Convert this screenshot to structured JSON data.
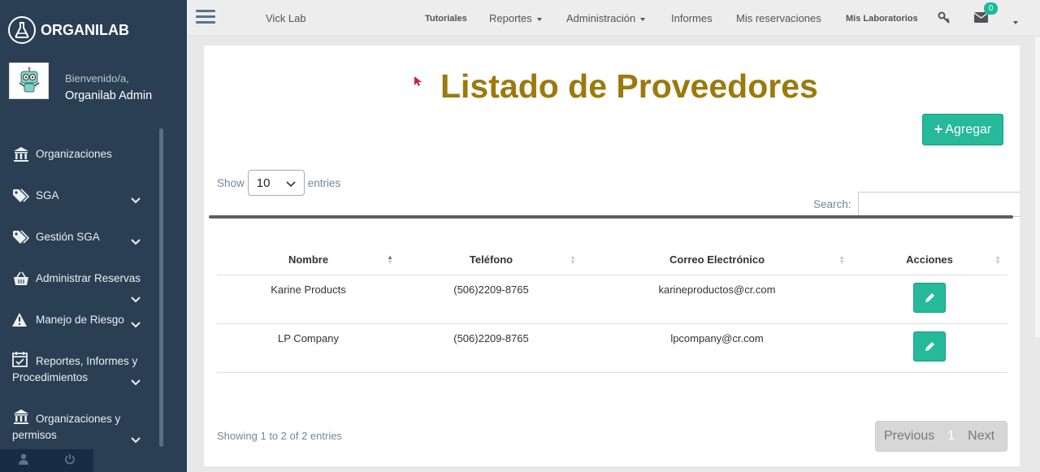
{
  "app": {
    "name": "ORGANILAB"
  },
  "profile": {
    "welcome": "Bienvenido/a,",
    "user": "Organilab Admin"
  },
  "sidebar": {
    "items": [
      {
        "label": "Organizaciones",
        "icon": "bank-icon"
      },
      {
        "label": "SGA",
        "icon": "tags-icon"
      },
      {
        "label": "Gestión SGA",
        "icon": "tags-icon"
      },
      {
        "label": "Administrar Reservas",
        "icon": "basket-icon"
      },
      {
        "label": "Manejo de Riesgo",
        "icon": "warning-icon"
      },
      {
        "label": "Reportes, Informes y Procedimientos",
        "icon": "calendar-check-icon"
      },
      {
        "label": "Organizaciones y permisos",
        "icon": "bank-icon"
      }
    ]
  },
  "topnav": {
    "lab": "Vick Lab",
    "tutoriales": "Tutoriales",
    "reportes": "Reportes",
    "administracion": "Administración",
    "informes": "Informes",
    "reservaciones": "Mis reservaciones",
    "laboratorios": "Mis Laboratorios",
    "messages_count": "0"
  },
  "page": {
    "title": "Listado de Proveedores",
    "add_label": "Agregar",
    "show_label": "Show",
    "entries_label": "entries",
    "page_size": "10",
    "search_label": "Search:",
    "info": "Showing 1 to 2 of 2 entries",
    "pager": {
      "previous": "Previous",
      "current": "1",
      "next": "Next"
    }
  },
  "table": {
    "columns": [
      "Nombre",
      "Teléfono",
      "Correo Electrónico",
      "Acciones"
    ],
    "rows": [
      {
        "nombre": "Karine Products",
        "telefono": "(506)2209-8765",
        "correo": "karineproductos@cr.com"
      },
      {
        "nombre": "LP Company",
        "telefono": "(506)2209-8765",
        "correo": "lpcompany@cr.com"
      }
    ]
  },
  "colors": {
    "sidebar": "#2a3f54",
    "accent": "#26b99a",
    "title": "#9b7a0d"
  }
}
